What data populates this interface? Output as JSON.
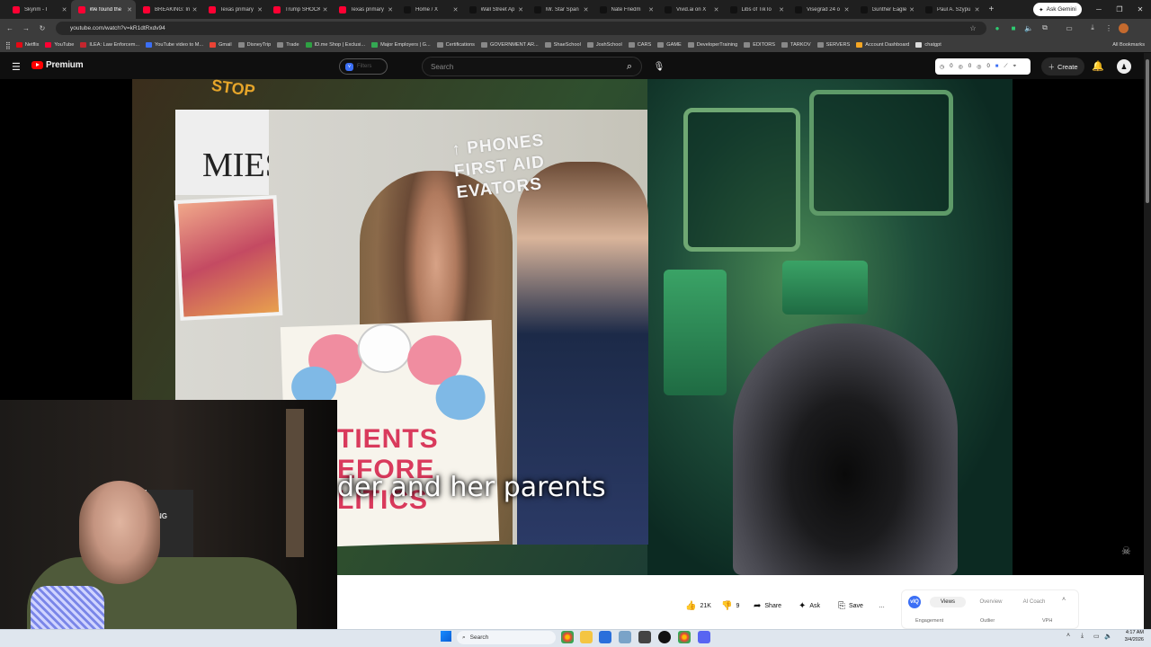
{
  "browser": {
    "tabs": [
      {
        "title": "Skyrim - I",
        "color": "#ff0033",
        "active": false
      },
      {
        "title": "We found the",
        "color": "#ff0033",
        "active": true
      },
      {
        "title": "BREAKING: In",
        "color": "#ff0033",
        "active": false
      },
      {
        "title": "Texas primary",
        "color": "#ff0033",
        "active": false
      },
      {
        "title": "Trump SHOCK",
        "color": "#ff0033",
        "active": false
      },
      {
        "title": "Texas primary",
        "color": "#ff0033",
        "active": false
      },
      {
        "title": "Home / X",
        "color": "#111111",
        "active": false
      },
      {
        "title": "Wall Street Ap",
        "color": "#111111",
        "active": false
      },
      {
        "title": "Mr. Star Span",
        "color": "#111111",
        "active": false
      },
      {
        "title": "Nate Friedm",
        "color": "#111111",
        "active": false
      },
      {
        "title": "Vivid.ai on X",
        "color": "#111111",
        "active": false
      },
      {
        "title": "Libs of TikTo",
        "color": "#111111",
        "active": false
      },
      {
        "title": "Visegrád 24 o",
        "color": "#111111",
        "active": false
      },
      {
        "title": "Gunther Eagle",
        "color": "#111111",
        "active": false
      },
      {
        "title": "Paul A. Szypu",
        "color": "#111111",
        "active": false
      }
    ],
    "new_tab": "+",
    "ask_gemini": "Ask Gemini",
    "url": "youtube.com/watch?v=kR1dtRxdv94",
    "bookmarks": [
      "Netflix",
      "YouTube",
      "ILEA: Law Enforcem...",
      "YouTube video to M...",
      "Gmail",
      "DisneyTrip",
      "Trade",
      "ID.me Shop | Exclusi...",
      "Major Employers | G...",
      "Certifications",
      "GOVERNMENT AR...",
      "ShaeSchool",
      "JoshSchool",
      "CARS",
      "GAME",
      "DeveloperTraining",
      "EDITORS",
      "TARKOV",
      "SERVERS",
      "Account Dashboard",
      "chatgpt"
    ],
    "all_bookmarks": "All Bookmarks"
  },
  "youtube": {
    "logo_text": "Premium",
    "filter_label": "Filters",
    "search_placeholder": "Search",
    "ext_counts": [
      "0",
      "0",
      "0"
    ],
    "create_label": "Create"
  },
  "video": {
    "caption": "der and her parents",
    "wall_sign": "↑ PHONES\nFIRST AID\nEVATORS",
    "sign_left": "MIES",
    "poster_text": "TIENTS\nEFORE\nLITICS",
    "stop_sign": "STOP",
    "chair_label": "CING"
  },
  "actions": {
    "likes": "21K",
    "dislikes": "9",
    "share": "Share",
    "ask": "Ask",
    "save": "Save",
    "more": "…"
  },
  "insights": {
    "logo": "vIQ",
    "tabs": [
      "Views",
      "Overview",
      "AI Coach"
    ],
    "subs": [
      "Engagement",
      "Outlier",
      "VPH"
    ]
  },
  "taskbar": {
    "search": "Search",
    "time": "4:17 AM",
    "date": "3/4/2026"
  }
}
